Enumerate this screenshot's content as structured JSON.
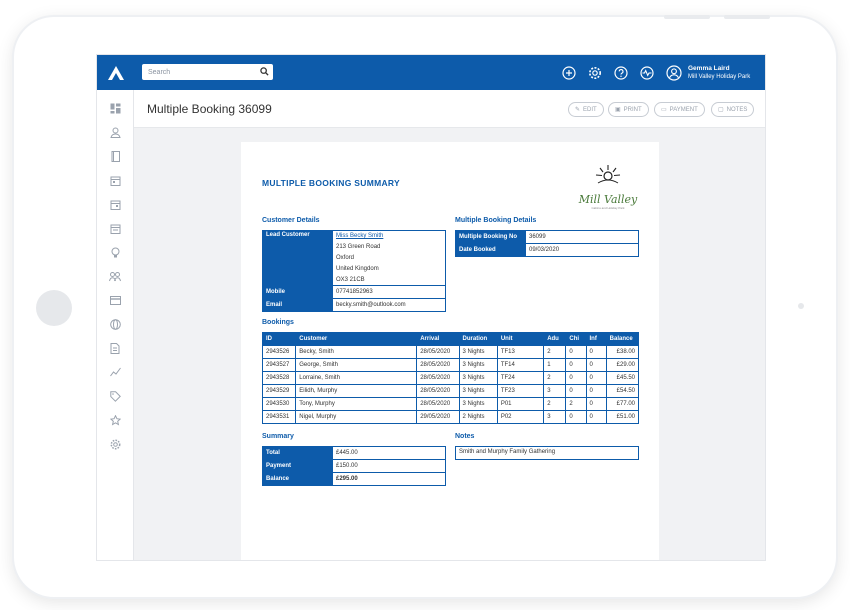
{
  "topbar": {
    "search_placeholder": "Search",
    "user_name": "Gemma Laird",
    "user_park": "Mill Valley Holiday Park"
  },
  "header": {
    "title": "Multiple Booking 36099",
    "buttons": {
      "edit": "EDIT",
      "print": "PRINT",
      "payment": "PAYMENT",
      "notes": "NOTES"
    }
  },
  "doc": {
    "title": "MULTIPLE BOOKING SUMMARY",
    "brand": {
      "name": "Mill Valley",
      "sub": "Cabins and Holiday Park"
    },
    "customer": {
      "heading": "Customer Details",
      "lead_label": "Lead Customer",
      "lead_name": "Miss Becky Smith",
      "address": [
        "213 Green Road",
        "Oxford",
        "United Kingdom",
        "OX3 21CB"
      ],
      "mobile_label": "Mobile",
      "mobile": "07741852963",
      "email_label": "Email",
      "email": "becky.smith@outlook.com"
    },
    "mb": {
      "heading": "Multiple Booking Details",
      "no_label": "Multiple Booking No",
      "no": "36099",
      "date_label": "Date Booked",
      "date": "09/03/2020"
    },
    "bookings": {
      "heading": "Bookings",
      "headers": [
        "ID",
        "Customer",
        "Arrival",
        "Duration",
        "Unit",
        "Adu",
        "Chi",
        "Inf",
        "Balance"
      ],
      "rows": [
        [
          "2943526",
          "Becky, Smith",
          "28/05/2020",
          "3 Nights",
          "TF13",
          "2",
          "0",
          "0",
          "£38.00"
        ],
        [
          "2943527",
          "George, Smith",
          "28/05/2020",
          "3 Nights",
          "TF14",
          "1",
          "0",
          "0",
          "£29.00"
        ],
        [
          "2943528",
          "Lorraine, Smith",
          "28/05/2020",
          "3 Nights",
          "TF24",
          "2",
          "0",
          "0",
          "£45.50"
        ],
        [
          "2943529",
          "Eilidh, Murphy",
          "28/05/2020",
          "3 Nights",
          "TF23",
          "3",
          "0",
          "0",
          "£54.50"
        ],
        [
          "2943530",
          "Tony, Murphy",
          "28/05/2020",
          "3 Nights",
          "P01",
          "2",
          "2",
          "0",
          "£77.00"
        ],
        [
          "2943531",
          "Nigel, Murphy",
          "29/05/2020",
          "2 Nights",
          "P02",
          "3",
          "0",
          "0",
          "£51.00"
        ]
      ]
    },
    "summary": {
      "heading": "Summary",
      "total_label": "Total",
      "total": "£445.00",
      "payment_label": "Payment",
      "payment": "£150.00",
      "balance_label": "Balance",
      "balance": "£295.00"
    },
    "notes": {
      "heading": "Notes",
      "text": "Smith and Murphy Family Gathering"
    }
  },
  "colors": {
    "brand_blue": "#0d5baa",
    "brand_green": "#4a7a3a"
  },
  "icons": {
    "topbar": [
      "plus-circle-icon",
      "gear-icon",
      "help-icon",
      "activity-icon",
      "user-icon"
    ],
    "sidebar": [
      "dashboard-icon",
      "user-icon",
      "book-icon",
      "calendar-icon",
      "calendar-icon",
      "calendar-icon",
      "lightbulb-icon",
      "group-icon",
      "card-icon",
      "globe-icon",
      "document-icon",
      "chart-icon",
      "tag-icon",
      "star-icon",
      "gear-icon"
    ]
  }
}
